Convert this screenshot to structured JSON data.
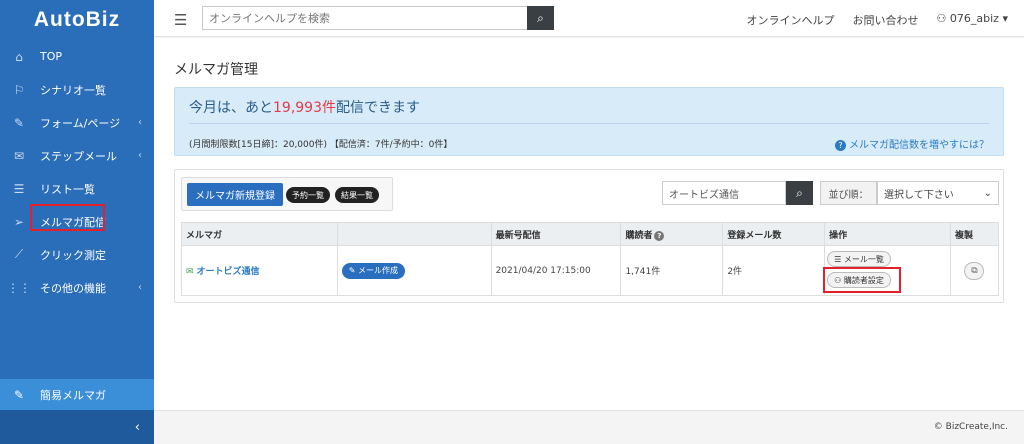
{
  "sidebar": {
    "logo": "AutoBiz",
    "items": [
      {
        "label": "TOP",
        "icon": "home-icon",
        "glyph": "⌂",
        "chev": ""
      },
      {
        "label": "シナリオ一覧",
        "icon": "flag-icon",
        "glyph": "⚐",
        "chev": ""
      },
      {
        "label": "フォーム/ページ",
        "icon": "pencil-icon",
        "glyph": "✎",
        "chev": "‹"
      },
      {
        "label": "ステップメール",
        "icon": "envelope-icon",
        "glyph": "✉",
        "chev": "‹"
      },
      {
        "label": "リスト一覧",
        "icon": "list-icon",
        "glyph": "☰",
        "chev": ""
      },
      {
        "label": "メルマガ配信",
        "icon": "send-icon",
        "glyph": "➢",
        "chev": ""
      },
      {
        "label": "クリック測定",
        "icon": "chart-icon",
        "glyph": "⟋",
        "chev": ""
      },
      {
        "label": "その他の機能",
        "icon": "grid-icon",
        "glyph": "⋮⋮",
        "chev": "‹"
      }
    ],
    "bottom_item": {
      "label": "簡易メルマガ",
      "glyph": "✎"
    },
    "collapse_glyph": "‹"
  },
  "topbar": {
    "menu_glyph": "☰",
    "search_placeholder": "オンラインヘルプを検索",
    "search_glyph": "⌕",
    "links": [
      "オンラインヘルプ",
      "お問い合わせ"
    ],
    "user": "076_abiz",
    "user_glyph": "⚇",
    "user_caret": "▾"
  },
  "main": {
    "title": "メルマガ管理",
    "info": {
      "prefix": "今月は、あと",
      "count": "19,993件",
      "suffix": "配信できます",
      "sub": "(月間制限数[15日締]：20,000件) 【配信済：7件/予約中：0件】",
      "help_glyph": "?",
      "help": "メルマガ配信数を増やすには？"
    },
    "toolbar": {
      "new_button": "メルマガ新規登録",
      "reserve_button": "予約一覧",
      "result_button": "結果一覧",
      "filter_value": "オートビズ通信",
      "filter_glyph": "⌕",
      "sort_label": "並び順：",
      "sort_value": "選択して下さい",
      "sort_caret": "⌄"
    },
    "table": {
      "headers": [
        "メルマガ",
        "",
        "最新号配信",
        "購読者",
        "登録メール数",
        "操作",
        "複製"
      ],
      "header_q": "?",
      "rows": [
        {
          "env_glyph": "✉",
          "name": "オートビズ通信",
          "mail_button": "✎ メール作成",
          "latest": "2021/04/20 17:15:00",
          "subscribers": "1,741件",
          "mails": "2件",
          "op1": "☰ メール一覧",
          "op2": "⚇ 購読者設定",
          "copy_glyph": "⧉"
        }
      ]
    }
  },
  "footer": "© BizCreate,Inc."
}
